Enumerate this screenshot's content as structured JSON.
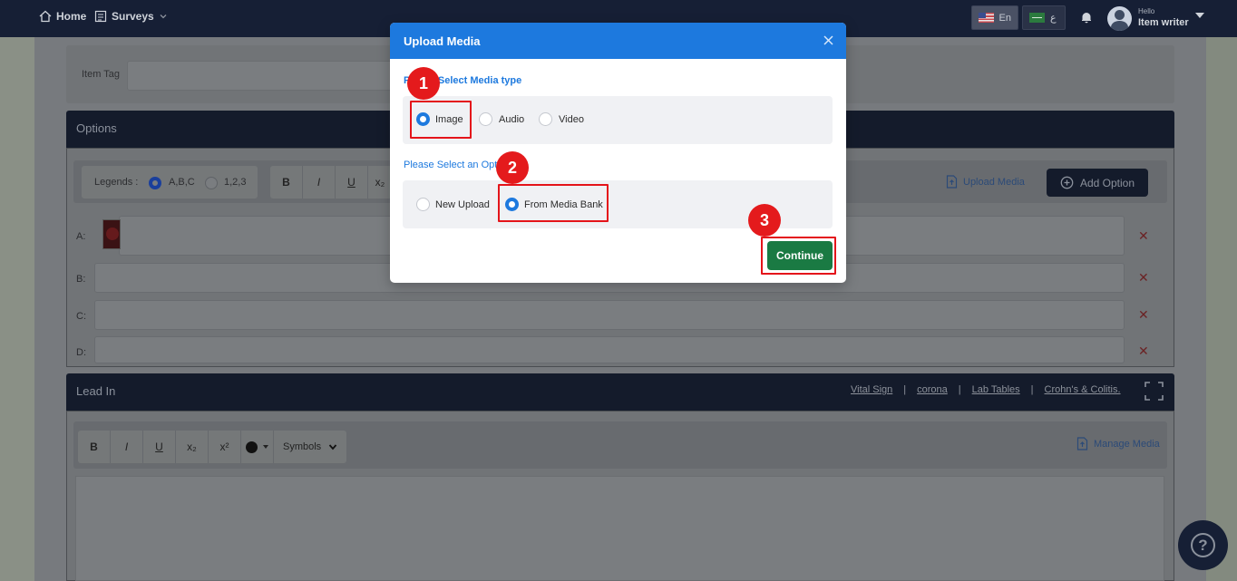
{
  "topbar": {
    "home_label": "Home",
    "surveys_label": "Surveys",
    "lang_en": "En",
    "lang_ar": "ع",
    "hello": "Hello",
    "user_name": "Item writer"
  },
  "item_tag": {
    "label": "Item Tag",
    "value": ""
  },
  "options_panel": {
    "title": "Options",
    "legends_label": "Legends :",
    "legend_options": [
      "A,B,C",
      "1,2,3"
    ],
    "legend_selected": "A,B,C",
    "format_buttons": [
      "B",
      "I",
      "U",
      "x₂"
    ],
    "upload_media": "Upload Media",
    "add_option": "Add Option",
    "rows": [
      {
        "letter": "A:"
      },
      {
        "letter": "B:"
      },
      {
        "letter": "C:"
      },
      {
        "letter": "D:"
      }
    ],
    "remove_glyph": "✕"
  },
  "lead_in": {
    "title": "Lead In",
    "links": [
      "Vital Sign",
      "corona",
      "Lab Tables",
      "Crohn's & Colitis."
    ],
    "separator": "|",
    "format_buttons": [
      "B",
      "I",
      "U",
      "x₂",
      "x²"
    ],
    "symbols_label": "Symbols",
    "manage_media": "Manage Media"
  },
  "help_glyph": "?",
  "modal": {
    "title": "Upload Media",
    "media_type_label": "Please Select Media type",
    "media_types": [
      "Image",
      "Audio",
      "Video"
    ],
    "media_type_selected": "Image",
    "option_label": "Please Select an Option",
    "upload_options": [
      "New Upload",
      "From Media Bank"
    ],
    "upload_option_selected": "From Media Bank",
    "continue_label": "Continue"
  },
  "callouts": [
    "1",
    "2",
    "3"
  ],
  "colors": {
    "modal_header": "#1d79de",
    "continue_button": "#1a7a43",
    "callout_red": "#e41a1c",
    "topbar": "#161f35"
  }
}
